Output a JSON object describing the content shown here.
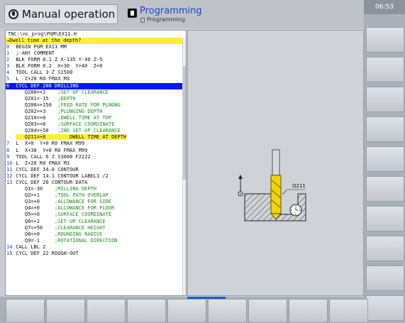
{
  "header": {
    "mode_label": "Manual operation",
    "active_mode": "Programming",
    "active_mode_sub": "Programming"
  },
  "clock": "06:53",
  "program": {
    "path": "TNC:\\nc_prog\\PGM\\EX11.H",
    "question": "→Dwell time at the depth?",
    "lines": [
      {
        "n": "0",
        "code": "BEGIN PGM EX11 MM",
        "comment": ""
      },
      {
        "n": "1",
        "code": ";-ANY COMMENT",
        "comment": ""
      },
      {
        "n": "2",
        "code": "BLK FORM 0.1 Z X-135 Y-40 Z-5",
        "comment": ""
      },
      {
        "n": "3",
        "code": "BLK FORM 0.2  X+30  Y+40  Z+0",
        "comment": ""
      },
      {
        "n": "4",
        "code": "TOOL CALL 3 Z S1500",
        "comment": ""
      },
      {
        "n": "5",
        "code": "L  Z+20 R0 FMAX M3",
        "comment": ""
      },
      {
        "n": "6",
        "code": "CYCL DEF 200 DRILLING",
        "comment": ""
      },
      {
        "n": "",
        "code": "   Q200=+2    ",
        "comment": ";SET-UP CLEARANCE"
      },
      {
        "n": "",
        "code": "   Q201=-15   ",
        "comment": ";DEPTH"
      },
      {
        "n": "",
        "code": "   Q206=+150  ",
        "comment": ";FEED RATE FOR PLNGNG"
      },
      {
        "n": "",
        "code": "   Q202=+3    ",
        "comment": ";PLUNGING DEPTH"
      },
      {
        "n": "",
        "code": "   Q210=+0    ",
        "comment": ";DWELL TIME AT TOP"
      },
      {
        "n": "",
        "code": "   Q203=+0    ",
        "comment": ";SURFACE COORDINATE"
      },
      {
        "n": "",
        "code": "   Q204=+50   ",
        "comment": ";2ND SET-UP CLEARANCE"
      },
      {
        "n": "",
        "code": "   Q211=+0",
        "comment": "        DWELL TIME AT DEPTH"
      },
      {
        "n": "7",
        "code": "L  X+0  Y+0 R0 FMAX M99",
        "comment": ""
      },
      {
        "n": "8",
        "code": "L  X+30  Y+0 R0 FMAX M99",
        "comment": ""
      },
      {
        "n": "9",
        "code": "TOOL CALL 6 Z S3000 F2222",
        "comment": ""
      },
      {
        "n": "10",
        "code": "L  Z+20 R0 FMAX M3",
        "comment": ""
      },
      {
        "n": "11",
        "code": "CYCL DEF 14.0 CONTOUR",
        "comment": ""
      },
      {
        "n": "12",
        "code": "CYCL DEF 14.1 CONTOUR LABEL1 /2",
        "comment": ""
      },
      {
        "n": "13",
        "code": "CYCL DEF 20 CONTOUR DATA",
        "comment": ""
      },
      {
        "n": "",
        "code": "   Q1=-30    ",
        "comment": ";MILLING DEPTH"
      },
      {
        "n": "",
        "code": "   Q2=+1     ",
        "comment": ";TOOL PATH OVERLAP"
      },
      {
        "n": "",
        "code": "   Q3=+0     ",
        "comment": ";ALLOWANCE FOR SIDE"
      },
      {
        "n": "",
        "code": "   Q4=+0     ",
        "comment": ";ALLOWANCE FOR FLOOR"
      },
      {
        "n": "",
        "code": "   Q5=+0     ",
        "comment": ";SURFACE COORDINATE"
      },
      {
        "n": "",
        "code": "   Q6=+2     ",
        "comment": ";SET-UP CLEARANCE"
      },
      {
        "n": "",
        "code": "   Q7=+50    ",
        "comment": ";CLEARANCE HEIGHT"
      },
      {
        "n": "",
        "code": "   Q8=+0     ",
        "comment": ";ROUNDING RADIUS"
      },
      {
        "n": "",
        "code": "   Q9=-1     ",
        "comment": ";ROTATIONAL DIRECTION"
      },
      {
        "n": "14",
        "code": "CALL LBL 2",
        "comment": ""
      },
      {
        "n": "15",
        "code": "CYCL DEF 22 ROUGH-OUT",
        "comment": ""
      }
    ]
  },
  "graphic": {
    "param_label": "Q211"
  },
  "colors": {
    "selection": "#0018ff",
    "highlight": "#ffef33",
    "comment": "#1d8b1d",
    "line_number": "#1a3ee0",
    "active_softkey": "#1a5bd6"
  }
}
